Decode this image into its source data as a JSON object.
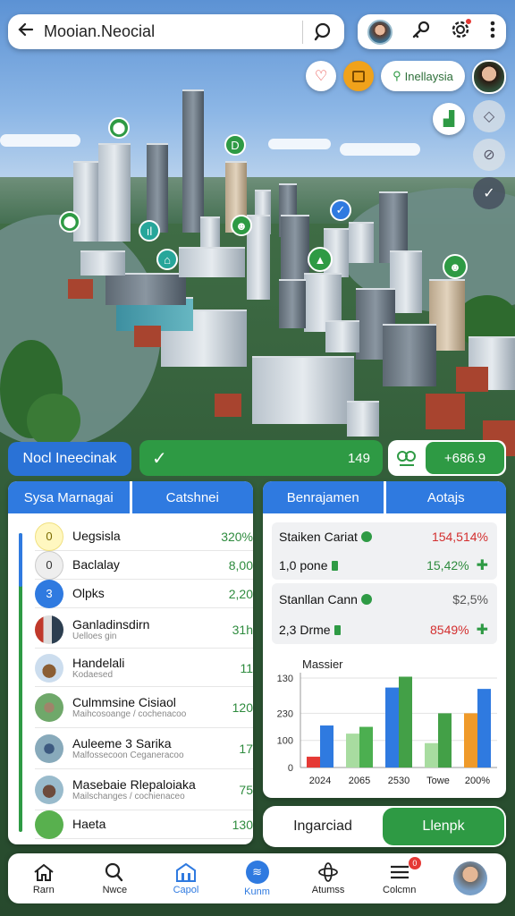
{
  "header": {
    "back_icon": "arrow-left-icon",
    "title": "Mooian.Neocial",
    "search_icon": "search-icon"
  },
  "actions": {
    "icons": [
      "avatar",
      "key-icon",
      "settings-icon",
      "more-vert-icon"
    ]
  },
  "chips": {
    "location_label": "Inellaysia"
  },
  "status_bar": {
    "left_label": "Nocl Ineecinak",
    "progress_value": "149",
    "group_value": "+686.9",
    "progress_fraction": 0.85
  },
  "left_panel": {
    "tabs": [
      "Sysa Marnagai",
      "Catshnei"
    ],
    "items": [
      {
        "marker": "0",
        "name": "Uegsisla",
        "sub": "",
        "value": "320%"
      },
      {
        "marker": "0",
        "name": "Baclalay",
        "sub": "",
        "value": "8,00"
      },
      {
        "marker": "3",
        "name": "Olpks",
        "sub": "",
        "value": "2,20"
      },
      {
        "marker": "",
        "name": "Ganladinsdirn",
        "sub": "Uelloes gin",
        "value": "31h"
      },
      {
        "marker": "",
        "name": "Handelali",
        "sub": "Kodaesed",
        "value": "11"
      },
      {
        "marker": "",
        "name": "Culmmsine Cisiaol",
        "sub": "Maihcosoange / cochenacoo",
        "value": "120"
      },
      {
        "marker": "",
        "name": "Auleeme 3 Sarika",
        "sub": "Malfossecoon Ceganeracoo",
        "value": "17"
      },
      {
        "marker": "",
        "name": "Masebaie Rlepaloiaka",
        "sub": "Mailschanges / cochienaceo",
        "value": "75"
      },
      {
        "marker": "",
        "name": "Haeta",
        "sub": "",
        "value": "130"
      }
    ]
  },
  "right_panel": {
    "tabs": [
      "Benrajamen",
      "Aotajs"
    ],
    "stats": [
      {
        "title": "Staiken Cariat",
        "title_value": "154,514%",
        "line2": "1,0 pone",
        "line2_value": "15,42%"
      },
      {
        "title": "Stanllan Cann",
        "title_value": "$2,5%",
        "line2": "2,3 Drme",
        "line2_value": "8549%"
      }
    ],
    "chart_title": "Massier"
  },
  "chart_data": {
    "type": "bar",
    "title": "Massier",
    "categories": [
      "2024",
      "2065",
      "2530",
      "Towe",
      "200%"
    ],
    "y_ticks": [
      "0",
      "100",
      "230",
      "130"
    ],
    "ylim": [
      0,
      330
    ],
    "series": [
      {
        "color": "#e53935",
        "values": [
          40,
          0,
          0,
          0,
          0
        ]
      },
      {
        "color": "#2f7ae0",
        "values": [
          155,
          0,
          0,
          0,
          0
        ]
      },
      {
        "color": "#a8dca0",
        "values": [
          0,
          125,
          0,
          90,
          0
        ]
      },
      {
        "color": "#4caf50",
        "values": [
          0,
          150,
          0,
          0,
          0
        ]
      },
      {
        "color": "#2f7ae0",
        "values": [
          0,
          0,
          295,
          0,
          0
        ]
      },
      {
        "color": "#43a047",
        "values": [
          0,
          0,
          335,
          0,
          0
        ]
      },
      {
        "color": "#43a047",
        "values": [
          0,
          0,
          0,
          200,
          0
        ]
      },
      {
        "color": "#ef9a2a",
        "values": [
          0,
          0,
          0,
          0,
          200
        ]
      },
      {
        "color": "#2f7ae0",
        "values": [
          0,
          0,
          0,
          0,
          290
        ]
      }
    ],
    "grid": true
  },
  "bottom_buttons": {
    "left": "Ingarciad",
    "right": "Llenpk"
  },
  "nav": [
    {
      "icon": "home-icon",
      "label": "Rarn"
    },
    {
      "icon": "search-icon",
      "label": "Nwce"
    },
    {
      "icon": "building-icon",
      "label": "Capol"
    },
    {
      "icon": "layers-icon",
      "label": "Kunm"
    },
    {
      "icon": "atom-icon",
      "label": "Atumss"
    },
    {
      "icon": "list-icon",
      "label": "Colcmn",
      "badge": "0"
    },
    {
      "icon": "profile-avatar",
      "label": ""
    }
  ],
  "colors": {
    "accent_blue": "#2f7ae0",
    "accent_green": "#2e9a44",
    "negative_red": "#d32f2f"
  }
}
